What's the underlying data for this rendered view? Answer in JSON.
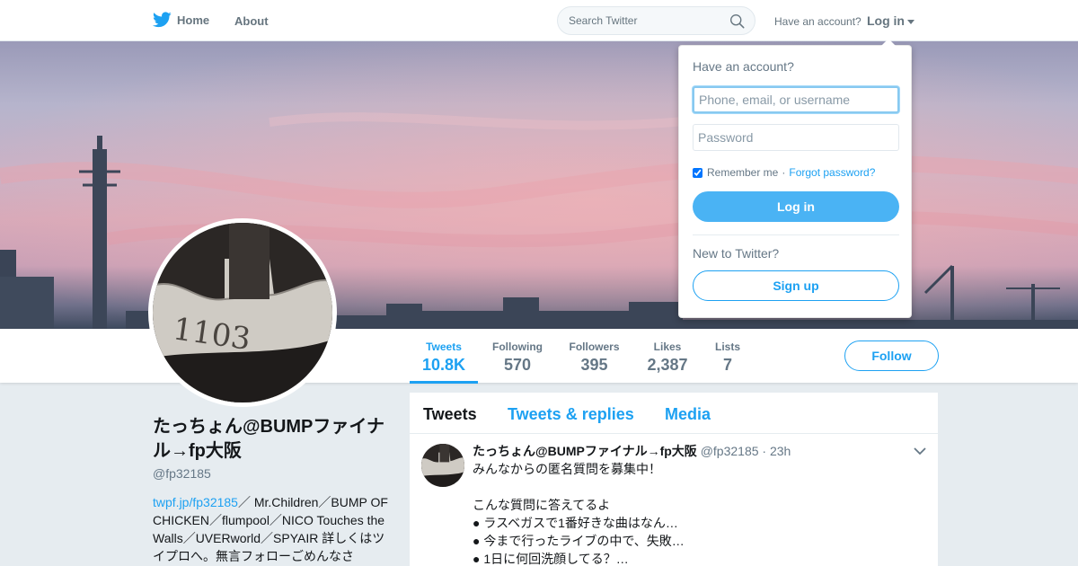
{
  "nav": {
    "home_label": "Home",
    "about_label": "About",
    "search_placeholder": "Search Twitter",
    "have_account": "Have an account?",
    "login_label": "Log in"
  },
  "profile": {
    "name": "たっちょん@BUMPファイナル→fp大阪",
    "handle": "@fp32185",
    "bio_link": "twpf.jp/fp32185",
    "bio_text": "／ Mr.Children／BUMP OF CHICKEN／flumpool／NICO Touches the Walls／UVERworld／SPYAIR 詳しくはツイプロへ。無言フォローごめんなさ",
    "avatar_text": "1103"
  },
  "stats": [
    {
      "label": "Tweets",
      "value": "10.8K"
    },
    {
      "label": "Following",
      "value": "570"
    },
    {
      "label": "Followers",
      "value": "395"
    },
    {
      "label": "Likes",
      "value": "2,387"
    },
    {
      "label": "Lists",
      "value": "7"
    }
  ],
  "follow_label": "Follow",
  "timeline": {
    "tabs": [
      "Tweets",
      "Tweets & replies",
      "Media"
    ],
    "tweet": {
      "name": "たっちょん@BUMPファイナル→fp大阪",
      "handle": "@fp32185",
      "time": "23h",
      "lines": [
        "みんなからの匿名質問を募集中！",
        "",
        "こんな質問に答えてるよ",
        "● ラスベガスで1番好きな曲はなん…",
        "● 今まで行ったライブの中で、失敗…",
        "● 1日に何回洗顔してる？…"
      ]
    }
  },
  "login_dropdown": {
    "title": "Have an account?",
    "username_placeholder": "Phone, email, or username",
    "password_placeholder": "Password",
    "remember_label": "Remember me",
    "separator": "·",
    "forgot_label": "Forgot password?",
    "login_button": "Log in",
    "new_label": "New to Twitter?",
    "signup_button": "Sign up"
  },
  "colors": {
    "accent": "#1da1f2",
    "login_button": "#4ab3f4",
    "page_background": "#e6ecf0"
  }
}
